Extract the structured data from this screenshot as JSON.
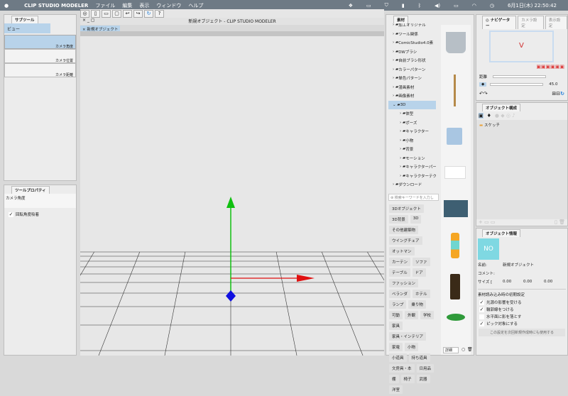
{
  "menubar": {
    "app": "CLIP STUDIO MODELER",
    "items": [
      "ファイル",
      "編集",
      "表示",
      "ウィンドウ",
      "ヘルプ"
    ],
    "datetime": "6月1日(木)  22:50:42"
  },
  "subtool": {
    "tab": "サブツール",
    "group": "ビュー",
    "items": [
      "カメラ角度",
      "カメラ位置",
      "カメラ距離"
    ]
  },
  "toolprop": {
    "tab": "ツールプロパティ",
    "title": "カメラ角度",
    "checkbox": "回転角度吸着",
    "checked": true
  },
  "document": {
    "window_title": "新規オブジェクト - CLIP STUDIO MODELER",
    "tab": "新規オブジェクト"
  },
  "material": {
    "tab": "素材",
    "tree": [
      "加工オリジナル",
      "ツール関係",
      "ComicStudio4.0素",
      "DWブラシ",
      "自前ブラシ形状",
      "カラーパターン",
      "単色パターン",
      "漫画素材",
      "画像素材",
      "3D",
      "体型",
      "ポーズ",
      "キャラクター",
      "小物",
      "背景",
      "モーション",
      "キャラクターパー",
      "キャラクターテク",
      "ダウンロード"
    ],
    "selected": "3D",
    "search_placeholder": "検索キーワードを入力し",
    "tags": [
      "3Dオブジェクト",
      "3D背景",
      "3D",
      "その他建築物",
      "ウイングチェア",
      "オットマン",
      "カーテン",
      "ソファ",
      "テーブル",
      "ドア",
      "ファッション",
      "ベランダ",
      "ホテル",
      "ランプ",
      "乗り物",
      "可動",
      "外観",
      "学校",
      "家具",
      "家具・インテリア",
      "家電",
      "小物",
      "小道具",
      "持ち道具",
      "文房具・本",
      "日用品",
      "棚",
      "椅子",
      "武器",
      "洋室"
    ],
    "view_mode": "詳細"
  },
  "navigator": {
    "tabs": [
      "ナビゲーター",
      "カメラ設定",
      "表示設定"
    ],
    "distance_label": "距離",
    "angle_value": "45.0"
  },
  "objstruct": {
    "tab": "オブジェクト構成",
    "items": [
      "スケッチ"
    ]
  },
  "objinfo": {
    "tab": "オブジェクト情報",
    "thumb": "NO",
    "name_label": "名前:",
    "name_value": "新規オブジェクト",
    "comment_label": "コメント:",
    "size_label": "サイズ [",
    "size": [
      "0.00",
      "0.00",
      "0.00"
    ],
    "section": "素材読み込み時の初期設定",
    "options": [
      {
        "label": "光源の影響を受ける",
        "checked": true
      },
      {
        "label": "輪郭線をつける",
        "checked": true
      },
      {
        "label": "水平面に影を落とす",
        "checked": false
      },
      {
        "label": "ピック対象にする",
        "checked": true
      }
    ],
    "apply_button": "この設定を次回新規作成時にも使用する"
  },
  "colors": {
    "menubar": "#6e7a85",
    "selection": "#b8d3ea",
    "x_axis": "#e01010",
    "y_axis": "#10c010",
    "z_axis": "#1010e0"
  }
}
